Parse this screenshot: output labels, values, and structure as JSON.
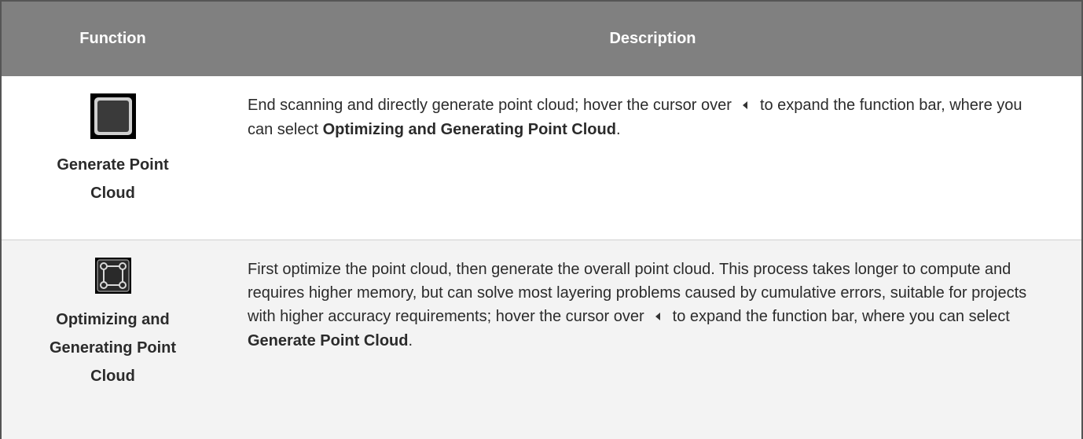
{
  "table": {
    "headers": {
      "function": "Function",
      "description": "Description"
    },
    "rows": [
      {
        "icon": "stop-square-icon",
        "function_label": "Generate Point Cloud",
        "desc_part1": "End scanning and directly generate point cloud; hover the cursor over",
        "desc_part2": "to expand the function bar, where you can select",
        "desc_bold": "Optimizing and Generating Point Cloud",
        "desc_end": "."
      },
      {
        "icon": "optimize-points-icon",
        "function_label": "Optimizing and Generating Point Cloud",
        "desc_part1": "First optimize the point cloud, then generate the overall point cloud. This process takes longer to compute and requires higher memory, but can solve most layering problems caused by cumulative errors, suitable for projects with higher accuracy requirements; hover the cursor over",
        "desc_part2": "to expand the function bar, where you can select",
        "desc_bold": "Generate Point Cloud",
        "desc_end": "."
      }
    ]
  }
}
